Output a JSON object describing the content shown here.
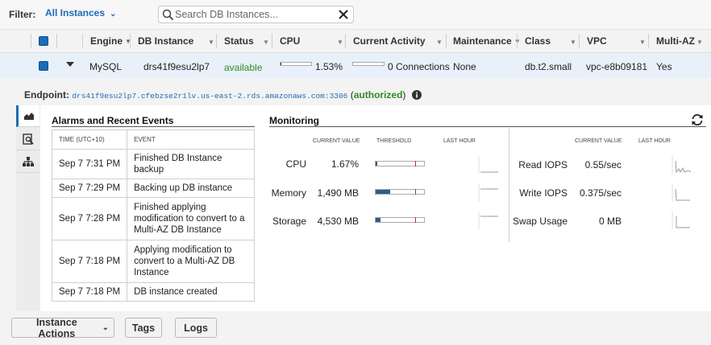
{
  "filter": {
    "label": "Filter:",
    "value": "All Instances",
    "search_placeholder": "Search DB Instances..."
  },
  "table": {
    "columns": [
      "Engine",
      "DB Instance",
      "Status",
      "CPU",
      "Current Activity",
      "Maintenance",
      "Class",
      "VPC",
      "Multi-AZ"
    ],
    "row": {
      "engine": "MySQL",
      "db_instance": "drs41f9esu2lp7",
      "status": "available",
      "cpu": "1.53%",
      "cpu_fraction": 0.0153,
      "activity": "0 Connections",
      "activity_fraction": 0,
      "maintenance": "None",
      "class": "db.t2.small",
      "vpc": "vpc-e8b09181",
      "multi_az": "Yes"
    }
  },
  "details": {
    "endpoint_label": "Endpoint:",
    "endpoint": "drs41f9esu2lp7.cfebzse2r1lv.us-east-2.rds.amazonaws.com:3306",
    "auth_open": "(",
    "auth": "authorized",
    "auth_close": ")"
  },
  "events": {
    "title": "Alarms and Recent Events",
    "time_header": "TIME (UTC+10)",
    "event_header": "EVENT",
    "rows": [
      {
        "time": "Sep 7 7:31 PM",
        "event": "Finished DB Instance backup"
      },
      {
        "time": "Sep 7 7:29 PM",
        "event": "Backing up DB instance"
      },
      {
        "time": "Sep 7 7:28 PM",
        "event": "Finished applying modification to convert to a Multi-AZ DB Instance"
      },
      {
        "time": "Sep 7 7:18 PM",
        "event": "Applying modification to convert to a Multi-AZ DB Instance"
      },
      {
        "time": "Sep 7 7:18 PM",
        "event": "DB instance created"
      }
    ]
  },
  "monitoring": {
    "title": "Monitoring",
    "headers": {
      "current_value": "CURRENT VALUE",
      "threshold": "THRESHOLD",
      "last_hour": "LAST HOUR"
    },
    "left": [
      {
        "label": "CPU",
        "value": "1.67%",
        "fill": 0.02
      },
      {
        "label": "Memory",
        "value": "1,490 MB",
        "fill": 0.3
      },
      {
        "label": "Storage",
        "value": "4,530 MB",
        "fill": 0.1
      }
    ],
    "right": [
      {
        "label": "Read IOPS",
        "value": "0.55/sec"
      },
      {
        "label": "Write IOPS",
        "value": "0.375/sec"
      },
      {
        "label": "Swap Usage",
        "value": "0 MB"
      }
    ]
  },
  "actions": {
    "instance_actions": "Instance Actions",
    "tags": "Tags",
    "logs": "Logs"
  },
  "colors": {
    "accent": "#1e6bb8",
    "available": "#2e8b22",
    "selected_row": "#e8f1fa",
    "threshold_fill": "#335a86"
  }
}
